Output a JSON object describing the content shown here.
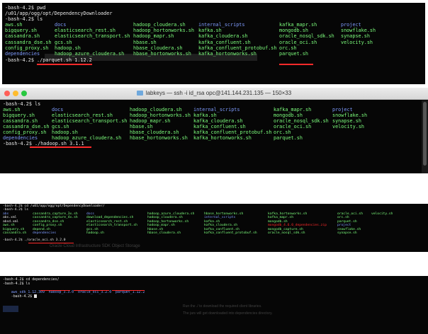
{
  "colors": {
    "terminal_bg": "#060606",
    "fg": "#e8e8e8",
    "dir": "#7f9cff",
    "script": "#7dff7d",
    "file": "#e8e8e8",
    "highlight": "#ff2a2a",
    "annotation_red": "#ff2a2a",
    "traffic_close": "#ff5f57",
    "traffic_min": "#febc2e",
    "traffic_max": "#28c840"
  },
  "panel1": {
    "lines": [
      "-bash-4.2$ pwd",
      "/u01/app/ogg/opt/DependencyDownloader",
      "-bash-4.2$ ls"
    ],
    "rows": [
      [
        "aws.sh",
        "docs",
        "hadoop_cloudera.sh",
        "internal_scripts",
        "kafka_mapr.sh",
        "project"
      ],
      [
        "bigquery.sh",
        "elasticsearch_rest.sh",
        "hadoop_hortonworks.sh",
        "kafka.sh",
        "mongodb.sh",
        "snowflake.sh"
      ],
      [
        "cassandra.sh",
        "elasticsearch_transport.sh",
        "hadoop_mapr.sh",
        "kafka_cloudera.sh",
        "oracle_nosql_sdk.sh",
        "synapse.sh"
      ],
      [
        "cassandra_dse.sh",
        "gcs.sh",
        "hbase.sh",
        "kafka_confluent.sh",
        "oracle_oci.sh",
        "velocity.sh"
      ],
      [
        "config_proxy.sh",
        "hadoop.sh",
        "hbase_cloudera.sh",
        "kafka_confluent_protobuf.sh",
        "orc.sh",
        ""
      ],
      [
        "dependencies",
        "hadoop_azure_cloudera.sh",
        "hbase_hortonworks.sh",
        "kafka_hortonworks.sh",
        "parquet.sh",
        ""
      ]
    ],
    "command": "-bash-4.2$ ./parquet.sh 1.12.2"
  },
  "panel2": {
    "title": "labkeys — ssh -i id_rsa opc@141.144.231.135 — 150×33",
    "lines": [
      "-bash-4.2$ ls"
    ],
    "rows": [
      [
        "aws.sh",
        "docs",
        "hadoop_cloudera.sh",
        "internal_scripts",
        "kafka_mapr.sh",
        "project"
      ],
      [
        "bigquery.sh",
        "elasticsearch_rest.sh",
        "hadoop_hortonworks.sh",
        "kafka.sh",
        "mongodb.sh",
        "snowflake.sh"
      ],
      [
        "cassandra.sh",
        "elasticsearch_transport.sh",
        "hadoop_mapr.sh",
        "kafka_cloudera.sh",
        "oracle_nosql_sdk.sh",
        "synapse.sh"
      ],
      [
        "cassandra_dse.sh",
        "gcs.sh",
        "hbase.sh",
        "kafka_confluent.sh",
        "oracle_oci.sh",
        "velocity.sh"
      ],
      [
        "config_proxy.sh",
        "hadoop.sh",
        "hbase_cloudera.sh",
        "kafka_confluent_protobuf.sh",
        "orc.sh",
        ""
      ],
      [
        "dependencies",
        "hadoop_azure_cloudera.sh",
        "hbase_hortonworks.sh",
        "kafka_hortonworks.sh",
        "parquet.sh",
        ""
      ]
    ],
    "command": "-bash-4.2$ ./hadoop.sh 3.1.1"
  },
  "panel3": {
    "lines": [
      "-bash-4.2$ cd /u01/app/ogg/opt/DependencyDownloader/",
      "-bash-4.2$ ls"
    ],
    "rows": [
      [
        "abs",
        "cassandra_capture_3x.sh",
        "docs",
        "hadoop_azure_cloudera.sh",
        "hbase_hortonworks.sh",
        "kafka_hortonworks.sh",
        "oracle_oci.sh",
        "velocity.sh"
      ],
      [
        "abs.xml",
        "cassandra_capture_4x.sh",
        "download_dependencies.sh",
        "hadoop_cloudera.sh",
        "internal_scripts",
        "kafka_mapr.sh",
        "orc.sh",
        ""
      ],
      [
        "absd.xml",
        "cassandra_dse.sh",
        "elasticsearch_rest.sh",
        "hadoop_hortonworks.sh",
        "kafka.sh",
        "mongodb.sh",
        "parquet.sh",
        ""
      ],
      [
        "aws.sh",
        "config_proxy.sh",
        "elasticsearch_transport.sh",
        "hadoop_mapr.sh",
        "kafka_cloudera.sh",
        "mongodb_4.6.0_dependencies.zip",
        "project",
        ""
      ],
      [
        "bigquery.sh",
        "depend.sh",
        "gcs.sh",
        "hbase.sh",
        "kafka_confluent.sh",
        "mongodb_capture.sh",
        "snowflake.sh",
        ""
      ],
      [
        "cassandra.sh",
        "dependencies",
        "hadoop.sh",
        "hbase_cloudera.sh",
        "kafka_confluent_protobuf.sh",
        "oracle_nosql_sdk.sh",
        "synapse.sh",
        ""
      ]
    ],
    "command": "-bash-4.2$ ./oracle_oci.sh 3.2.0",
    "bg_text": "Oracle Cloud Infrastructure SDK Object Storage"
  },
  "panel4": {
    "lines": [
      "-bash-4.2$ cd dependencies/",
      "-bash-4.2$ ls"
    ],
    "ls_items": [
      "aws_sdk_1.12.309",
      "hadoop_3.3.0",
      "oracle_oci_3.2.0",
      "parquet_1.12.2"
    ],
    "prompt": "-bash-4.2$ ",
    "bg_lines": [
      "Run the ./ to download the required client libraries.",
      "The jars will get downloaded into dependencies directory."
    ]
  }
}
